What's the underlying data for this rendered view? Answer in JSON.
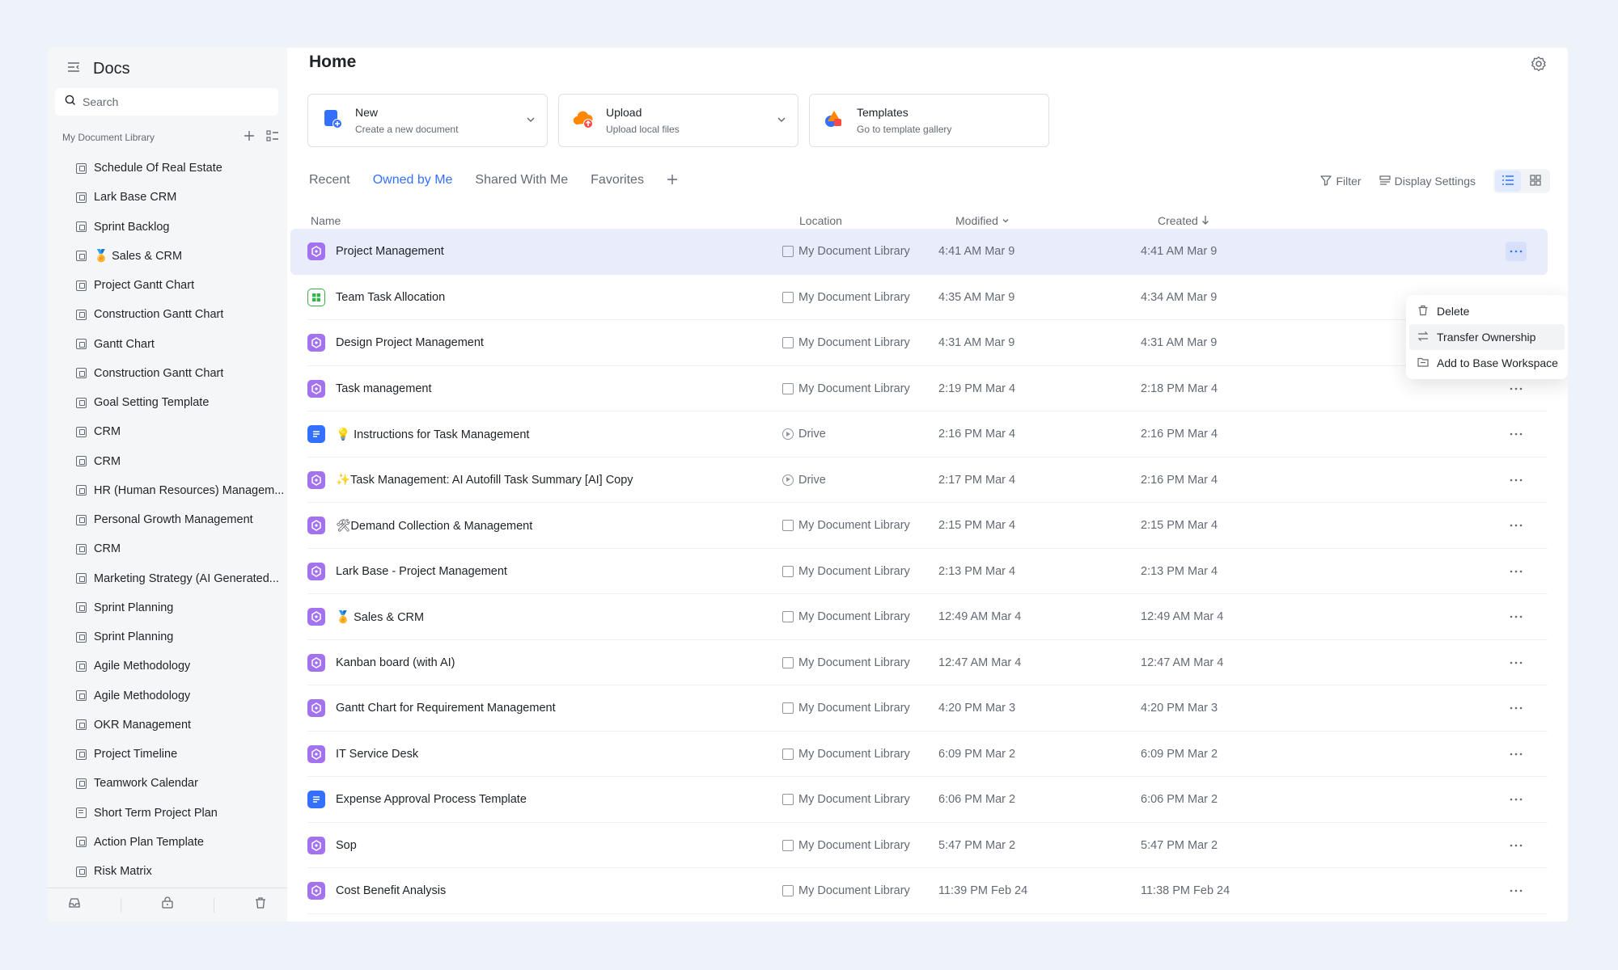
{
  "sidebar": {
    "app_title": "Docs",
    "search_placeholder": "Search",
    "library_label": "My Document Library",
    "items": [
      {
        "label": "Schedule Of Real Estate",
        "icon": "base-icon"
      },
      {
        "label": "Lark Base CRM",
        "icon": "base-icon"
      },
      {
        "label": "Sprint Backlog",
        "icon": "base-icon"
      },
      {
        "label": "🏅 Sales & CRM",
        "icon": "base-icon"
      },
      {
        "label": "Project Gantt Chart",
        "icon": "sheet-icon"
      },
      {
        "label": "Construction Gantt Chart",
        "icon": "base-icon"
      },
      {
        "label": "Gantt Chart",
        "icon": "base-icon"
      },
      {
        "label": "Construction Gantt Chart",
        "icon": "base-icon"
      },
      {
        "label": "Goal Setting Template",
        "icon": "base-icon"
      },
      {
        "label": "CRM",
        "icon": "base-icon"
      },
      {
        "label": "CRM",
        "icon": "base-icon"
      },
      {
        "label": "HR (Human Resources) Managem...",
        "icon": "base-icon"
      },
      {
        "label": "Personal Growth Management",
        "icon": "base-icon"
      },
      {
        "label": "CRM",
        "icon": "base-icon"
      },
      {
        "label": "Marketing Strategy  (AI Generated...",
        "icon": "base-icon"
      },
      {
        "label": "Sprint Planning",
        "icon": "base-icon"
      },
      {
        "label": "Sprint Planning",
        "icon": "base-icon"
      },
      {
        "label": "Agile Methodology",
        "icon": "base-icon"
      },
      {
        "label": "Agile Methodology",
        "icon": "base-icon"
      },
      {
        "label": "OKR Management",
        "icon": "base-icon"
      },
      {
        "label": "Project Timeline",
        "icon": "base-icon"
      },
      {
        "label": "Teamwork Calendar",
        "icon": "base-icon"
      },
      {
        "label": "Short Term Project Plan",
        "icon": "doc-icon"
      },
      {
        "label": "Action Plan Template",
        "icon": "base-icon"
      },
      {
        "label": "Risk Matrix",
        "icon": "base-icon"
      }
    ]
  },
  "header": {
    "title": "Home"
  },
  "cards": [
    {
      "title": "New",
      "subtitle": "Create a new document"
    },
    {
      "title": "Upload",
      "subtitle": "Upload local files"
    },
    {
      "title": "Templates",
      "subtitle": "Go to template gallery"
    }
  ],
  "tabs": [
    {
      "label": "Recent",
      "active": false
    },
    {
      "label": "Owned by Me",
      "active": true
    },
    {
      "label": "Shared With Me",
      "active": false
    },
    {
      "label": "Favorites",
      "active": false
    }
  ],
  "toolbar": {
    "filter": "Filter",
    "display_settings": "Display Settings"
  },
  "table": {
    "columns": {
      "name": "Name",
      "location": "Location",
      "modified": "Modified",
      "created": "Created"
    },
    "rows": [
      {
        "name": "Project Management",
        "type": "base",
        "location": "My Document Library",
        "modified": "4:41 AM Mar 9",
        "created": "4:41 AM Mar 9"
      },
      {
        "name": "Team Task Allocation",
        "type": "sheet",
        "location": "My Document Library",
        "modified": "4:35 AM Mar 9",
        "created": "4:34 AM Mar 9"
      },
      {
        "name": "Design Project Management",
        "type": "base",
        "location": "My Document Library",
        "modified": "4:31 AM Mar 9",
        "created": "4:31 AM Mar 9"
      },
      {
        "name": "Task management",
        "type": "base",
        "location": "My Document Library",
        "modified": "2:19 PM Mar 4",
        "created": "2:18 PM Mar 4"
      },
      {
        "name": "💡 Instructions for Task Management",
        "type": "doc",
        "location": "Drive",
        "modified": "2:16 PM Mar 4",
        "created": "2:16 PM Mar 4"
      },
      {
        "name": "✨Task Management: AI Autofill Task Summary [AI] Copy",
        "type": "base",
        "location": "Drive",
        "modified": "2:17 PM Mar 4",
        "created": "2:16 PM Mar 4"
      },
      {
        "name": "🛠Demand Collection & Management",
        "type": "base",
        "location": "My Document Library",
        "modified": "2:15 PM Mar 4",
        "created": "2:15 PM Mar 4"
      },
      {
        "name": "Lark Base - Project Management",
        "type": "base",
        "location": "My Document Library",
        "modified": "2:13 PM Mar 4",
        "created": "2:13 PM Mar 4"
      },
      {
        "name": "🏅 Sales & CRM",
        "type": "base",
        "location": "My Document Library",
        "modified": "12:49 AM Mar 4",
        "created": "12:49 AM Mar 4"
      },
      {
        "name": "Kanban board (with AI)",
        "type": "base",
        "location": "My Document Library",
        "modified": "12:47 AM Mar 4",
        "created": "12:47 AM Mar 4"
      },
      {
        "name": "Gantt Chart for Requirement Management",
        "type": "base",
        "location": "My Document Library",
        "modified": "4:20 PM Mar 3",
        "created": "4:20 PM Mar 3"
      },
      {
        "name": "IT Service Desk",
        "type": "base",
        "location": "My Document Library",
        "modified": "6:09 PM Mar 2",
        "created": "6:09 PM Mar 2"
      },
      {
        "name": "Expense Approval Process Template",
        "type": "doc",
        "location": "My Document Library",
        "modified": "6:06 PM Mar 2",
        "created": "6:06 PM Mar 2"
      },
      {
        "name": "Sop",
        "type": "base",
        "location": "My Document Library",
        "modified": "5:47 PM Mar 2",
        "created": "5:47 PM Mar 2"
      },
      {
        "name": "Cost Benefit Analysis",
        "type": "base",
        "location": "My Document Library",
        "modified": "11:39 PM Feb 24",
        "created": "11:38 PM Feb 24"
      }
    ]
  },
  "context_menu": {
    "items": [
      {
        "label": "Delete",
        "icon": "trash-icon"
      },
      {
        "label": "Transfer Ownership",
        "icon": "swap-icon"
      },
      {
        "label": "Add to Base Workspace",
        "icon": "folder-icon"
      }
    ]
  },
  "colors": {
    "accent": "#3370ff",
    "base": "#a372ef",
    "sheet": "#34b34a",
    "doc": "#3370ff",
    "selected_row": "#e8ecfb"
  }
}
